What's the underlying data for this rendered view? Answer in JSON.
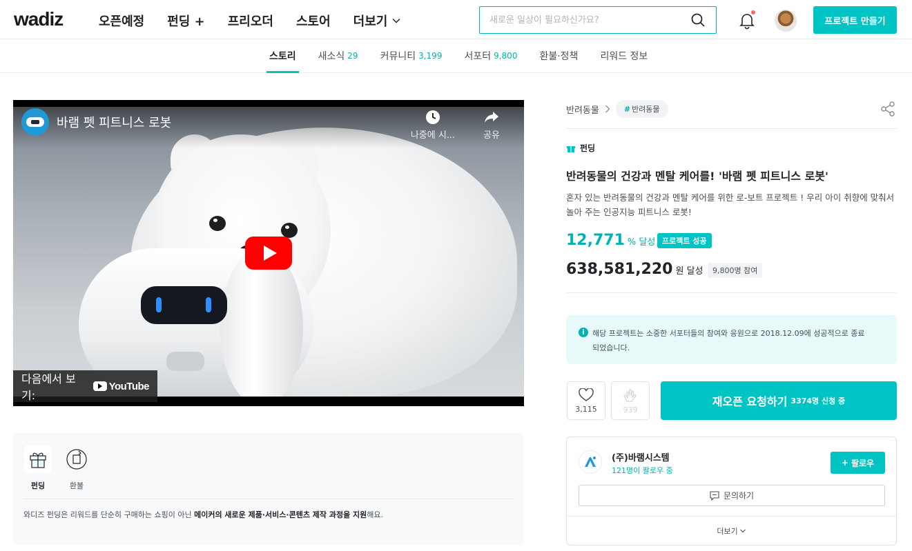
{
  "header": {
    "logo": "wadiz",
    "nav": [
      {
        "label": "오픈예정"
      },
      {
        "label": "펀딩 +"
      },
      {
        "label": "프리오더"
      },
      {
        "label": "스토어"
      },
      {
        "label": "더보기"
      }
    ],
    "search_placeholder": "새로운 일상이 필요하신가요?",
    "create_button": "프로젝트 만들기",
    "icons": {
      "search": "search-icon",
      "bell": "bell-icon",
      "avatar": "user-avatar",
      "more_chevron": "chevron-down-icon"
    }
  },
  "tabs": [
    {
      "label": "스토리",
      "count": "",
      "active": true
    },
    {
      "label": "새소식",
      "count": "29"
    },
    {
      "label": "커뮤니티",
      "count": "3,199"
    },
    {
      "label": "서포터",
      "count": "9,800"
    },
    {
      "label": "환불·정책",
      "count": ""
    },
    {
      "label": "리워드 정보",
      "count": ""
    }
  ],
  "video": {
    "title": "바램 펫 피트니스 로봇",
    "watch_later": "나중에 시...",
    "share": "공유",
    "watch_on": "다음에서 보기:",
    "youtube": "YouTube"
  },
  "info_box": {
    "tiles": [
      {
        "label": "펀딩",
        "icon": "gift-icon",
        "active": true
      },
      {
        "label": "환불",
        "icon": "refund-icon",
        "active": false
      }
    ],
    "text_pre": "와디즈 펀딩은 리워드를 단순히 구매하는 쇼핑이 아닌 ",
    "text_bold": "메이커의 새로운 제품·서비스·콘텐츠 제작 과정을 지원",
    "text_post": "해요."
  },
  "project": {
    "category": "반려동물",
    "tag": "반려동물",
    "tag_hash": "#",
    "type": "펀딩",
    "title": "반려동물의 건강과 멘탈 케어를! '바램 펫 피트니스 로봇'",
    "description": "혼자 있는 반려동물의 건강과 멘탈 케어를 위한 로-보트 프로젝트 ! 우리 아이 취향에 맞춰서 놀아 주는 인공지능 피트니스 로봇!",
    "rate": "12,771",
    "rate_unit": "% 달성",
    "success_badge": "프로젝트 성공",
    "amount": "638,581,220",
    "amount_unit": "원 달성",
    "participants": "9,800명 참여",
    "notice": "해당 프로젝트는 소중한 서포터들의 참여와 응원으로 2018.12.09에 성공적으로 종료되었습니다.",
    "notice_icon": "i",
    "like_count": "3,115",
    "cheer_count": "939",
    "reopen_label": "재오픈 요청하기",
    "reopen_sub": "3374명 신청 중"
  },
  "maker": {
    "name": "(주)바램시스템",
    "followers": "121명이 팔로우 중",
    "follow_label": "팔로우",
    "follow_plus": "+",
    "inquiry_label": "문의하기",
    "more_label": "더보기"
  },
  "colors": {
    "accent": "#00c4c4",
    "accent_text": "#00b2b2",
    "text": "#212529",
    "muted": "#495057"
  }
}
